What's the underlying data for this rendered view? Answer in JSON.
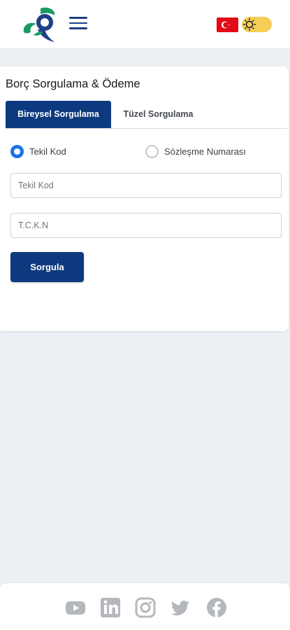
{
  "header": {
    "logo_icon": "brand-logo-icon",
    "menu_icon": "hamburger-menu-icon",
    "language_flag_icon": "turkey-flag-icon",
    "theme_toggle_icon": "sun-icon",
    "colors": {
      "brand_blue": "#1f3f86",
      "brand_green": "#1c9a64",
      "flag_red": "#e30a17",
      "toggle_yellow": "#f6cd57"
    }
  },
  "page": {
    "title": "Borç Sorgulama & Ödeme",
    "tabs": [
      {
        "label": "Bireysel Sorgulama",
        "active": true
      },
      {
        "label": "Tüzel Sorgulama",
        "active": false
      }
    ],
    "radios": [
      {
        "label": "Tekil Kod",
        "checked": true
      },
      {
        "label": "Sözleşme Numarası",
        "checked": false
      }
    ],
    "inputs": {
      "tekil_kod": {
        "placeholder": "Tekil Kod",
        "value": ""
      },
      "tckn": {
        "placeholder": "T.C.K.N",
        "value": ""
      }
    },
    "submit_label": "Sorgula",
    "colors": {
      "primary": "#0d3a7e",
      "radio_active": "#1a73e8"
    }
  },
  "footer": {
    "social_icons": [
      "youtube-icon",
      "linkedin-icon",
      "instagram-icon",
      "twitter-icon",
      "facebook-icon"
    ],
    "icon_color": "#b4b8bd"
  }
}
